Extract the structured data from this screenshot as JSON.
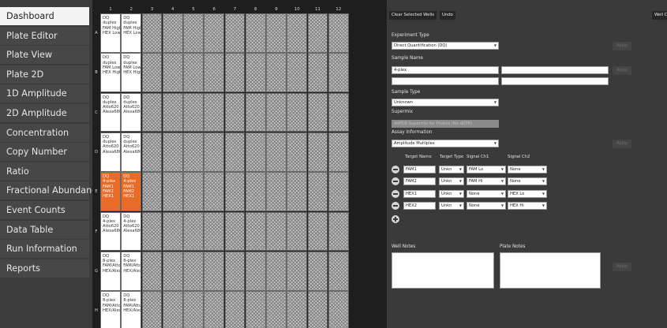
{
  "sidebar": {
    "items": [
      {
        "label": "Dashboard",
        "active": true
      },
      {
        "label": "Plate Editor"
      },
      {
        "label": "Plate View"
      },
      {
        "label": "Plate 2D"
      },
      {
        "label": "1D Amplitude"
      },
      {
        "label": "2D Amplitude"
      },
      {
        "label": "Concentration"
      },
      {
        "label": "Copy Number"
      },
      {
        "label": "Ratio"
      },
      {
        "label": "Fractional Abundance"
      },
      {
        "label": "Event Counts"
      },
      {
        "label": "Data Table"
      },
      {
        "label": "Run Information"
      },
      {
        "label": "Reports"
      }
    ]
  },
  "plate": {
    "columns": [
      "1",
      "2",
      "3",
      "4",
      "5",
      "6",
      "7",
      "8",
      "9",
      "10",
      "11",
      "12"
    ],
    "rows": [
      "A",
      "B",
      "C",
      "D",
      "E",
      "F",
      "G",
      "H"
    ],
    "selected_row": "E",
    "wells": {
      "A": [
        [
          "DQ",
          "duplex",
          "FAM High",
          "HEX Low"
        ],
        [
          "DQ",
          "duplex",
          "FAM High",
          "HEX Low"
        ]
      ],
      "B": [
        [
          "DQ",
          "duplex",
          "FAM Low",
          "HEX High"
        ],
        [
          "DQ",
          "duplex",
          "FAM Low",
          "HEX High"
        ]
      ],
      "C": [
        [
          "DQ",
          "duplex",
          "Atto620 H",
          "Alexa680"
        ],
        [
          "DQ",
          "duplex",
          "Atto620 H",
          "Alexa680"
        ]
      ],
      "D": [
        [
          "DQ",
          "duplex",
          "Atto620 L",
          "Alexa680"
        ],
        [
          "DQ",
          "duplex",
          "Atto620 L",
          "Alexa680"
        ]
      ],
      "E": [
        [
          "DQ",
          "4-plex",
          "FAM1",
          "FAM2",
          "HEX1"
        ],
        [
          "DQ",
          "4-plex",
          "FAM1",
          "FAM2",
          "HEX1"
        ]
      ],
      "F": [
        [
          "DQ",
          "4-plex",
          "Atto620",
          "Alexa680"
        ],
        [
          "DQ",
          "4-plex",
          "Atto620",
          "Alexa680"
        ]
      ],
      "G": [
        [
          "DQ",
          "8-plex",
          "FAM/Atto",
          "HEX/Alexa"
        ],
        [
          "DQ",
          "8-plex",
          "FAM/Atto",
          "HEX/Alexa"
        ]
      ],
      "H": [
        [
          "DQ",
          "8-plex",
          "FAM/Atto",
          "HEX/Alexa"
        ],
        [
          "DQ",
          "8-plex",
          "FAM/Atto",
          "HEX/Alexa"
        ]
      ]
    }
  },
  "setup": {
    "clear_label": "Clear Selected Wells",
    "undo_label": "Undo",
    "well_partial_label": "Well D",
    "experiment_type_label": "Experiment Type",
    "experiment_type_value": "Direct Quantification (DQ)",
    "sample_name_label": "Sample Name",
    "sample_name_1": "4-plex",
    "sample_type_label": "Sample Type",
    "sample_type_value": "Unknown",
    "supermix_label": "Supermix",
    "supermix_value": "ddPCR Supermix for Probes (No dUTP)",
    "assay_label": "Assay Information",
    "assay_value": "Amplitude Multiplex",
    "apply_label": "Apply",
    "targets_header": {
      "name": "Target Name",
      "type": "Target Type",
      "ch1": "Signal Ch1",
      "ch2": "Signal Ch2"
    },
    "targets": [
      {
        "name": "FAM1",
        "type": "Unkn",
        "ch1": "FAM Lo",
        "ch2": "None"
      },
      {
        "name": "FAM2",
        "type": "Unkn",
        "ch1": "FAM Hi",
        "ch2": "None"
      },
      {
        "name": "HEX1",
        "type": "Unkn",
        "ch1": "None",
        "ch2": "HEX Lo"
      },
      {
        "name": "HEX2",
        "type": "Unkn",
        "ch1": "None",
        "ch2": "HEX Hi"
      }
    ],
    "well_notes_label": "Well Notes",
    "plate_notes_label": "Plate Notes"
  }
}
